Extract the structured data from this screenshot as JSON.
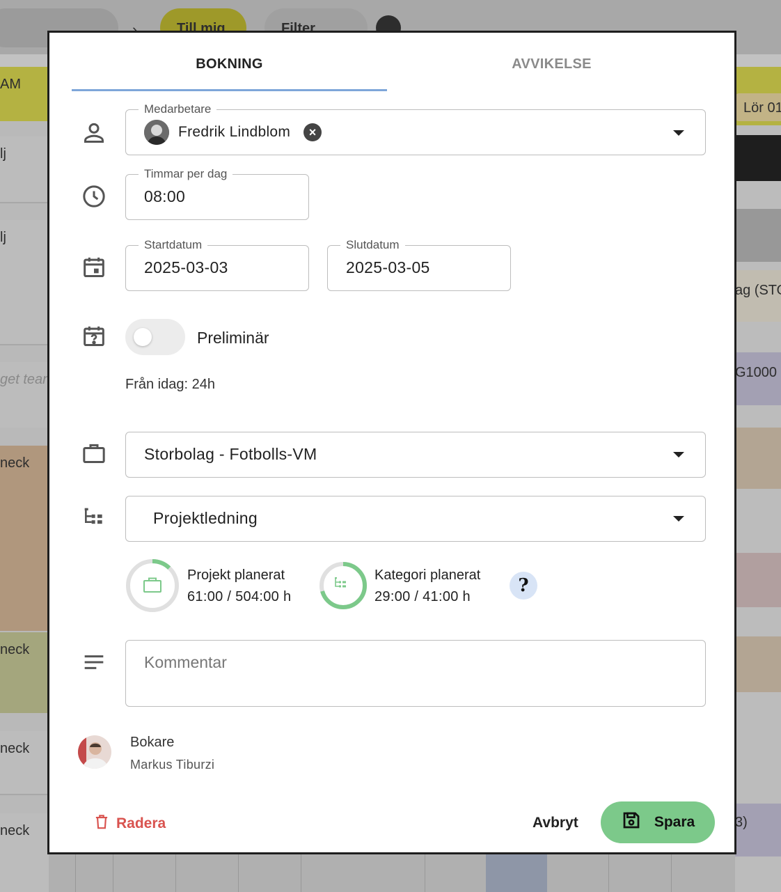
{
  "background": {
    "search_text": "",
    "me_button": "Till mig",
    "filter_button": "Filter",
    "left_labels": [
      "AM",
      "lj",
      "lj",
      "get tean",
      "neck",
      "neck",
      "neck",
      "neck"
    ],
    "right_labels": [
      "Lör 01",
      "ag (STO",
      "G1000",
      "3)"
    ]
  },
  "tabs": [
    {
      "label": "BOKNING",
      "active": true
    },
    {
      "label": "AVVIKELSE",
      "active": false
    }
  ],
  "employee": {
    "legend": "Medarbetare",
    "value": "Fredrik Lindblom",
    "clear_icon": "close-circle-icon"
  },
  "hours": {
    "legend": "Timmar per dag",
    "value": "08:00"
  },
  "dates": {
    "start_legend": "Startdatum",
    "start_value": "2025-03-03",
    "end_legend": "Slutdatum",
    "end_value": "2025-03-05"
  },
  "preliminary": {
    "label": "Preliminär",
    "enabled": false
  },
  "from_today": "Från idag: 24h",
  "project": {
    "value": "Storbolag - Fotbolls-VM"
  },
  "category": {
    "value": "Projektledning"
  },
  "stats": {
    "project_title": "Projekt planerat",
    "project_value": "61:00 / 504:00 h",
    "project_fraction": 0.121,
    "category_title": "Kategori planerat",
    "category_value": "29:00 / 41:00 h",
    "category_fraction": 0.707,
    "help_symbol": "?"
  },
  "comment": {
    "placeholder": "Kommentar"
  },
  "booker": {
    "label": "Bokare",
    "name": "Markus Tiburzi"
  },
  "actions": {
    "delete_label": "Radera",
    "cancel_label": "Avbryt",
    "save_label": "Spara"
  },
  "colors": {
    "accent": "#7ea6d9",
    "ring": "#7cc98a",
    "ring_track": "#e0e0e0",
    "save_button": "#7cc98a",
    "delete": "#d9534f",
    "help_bg": "#d8e4f6"
  }
}
